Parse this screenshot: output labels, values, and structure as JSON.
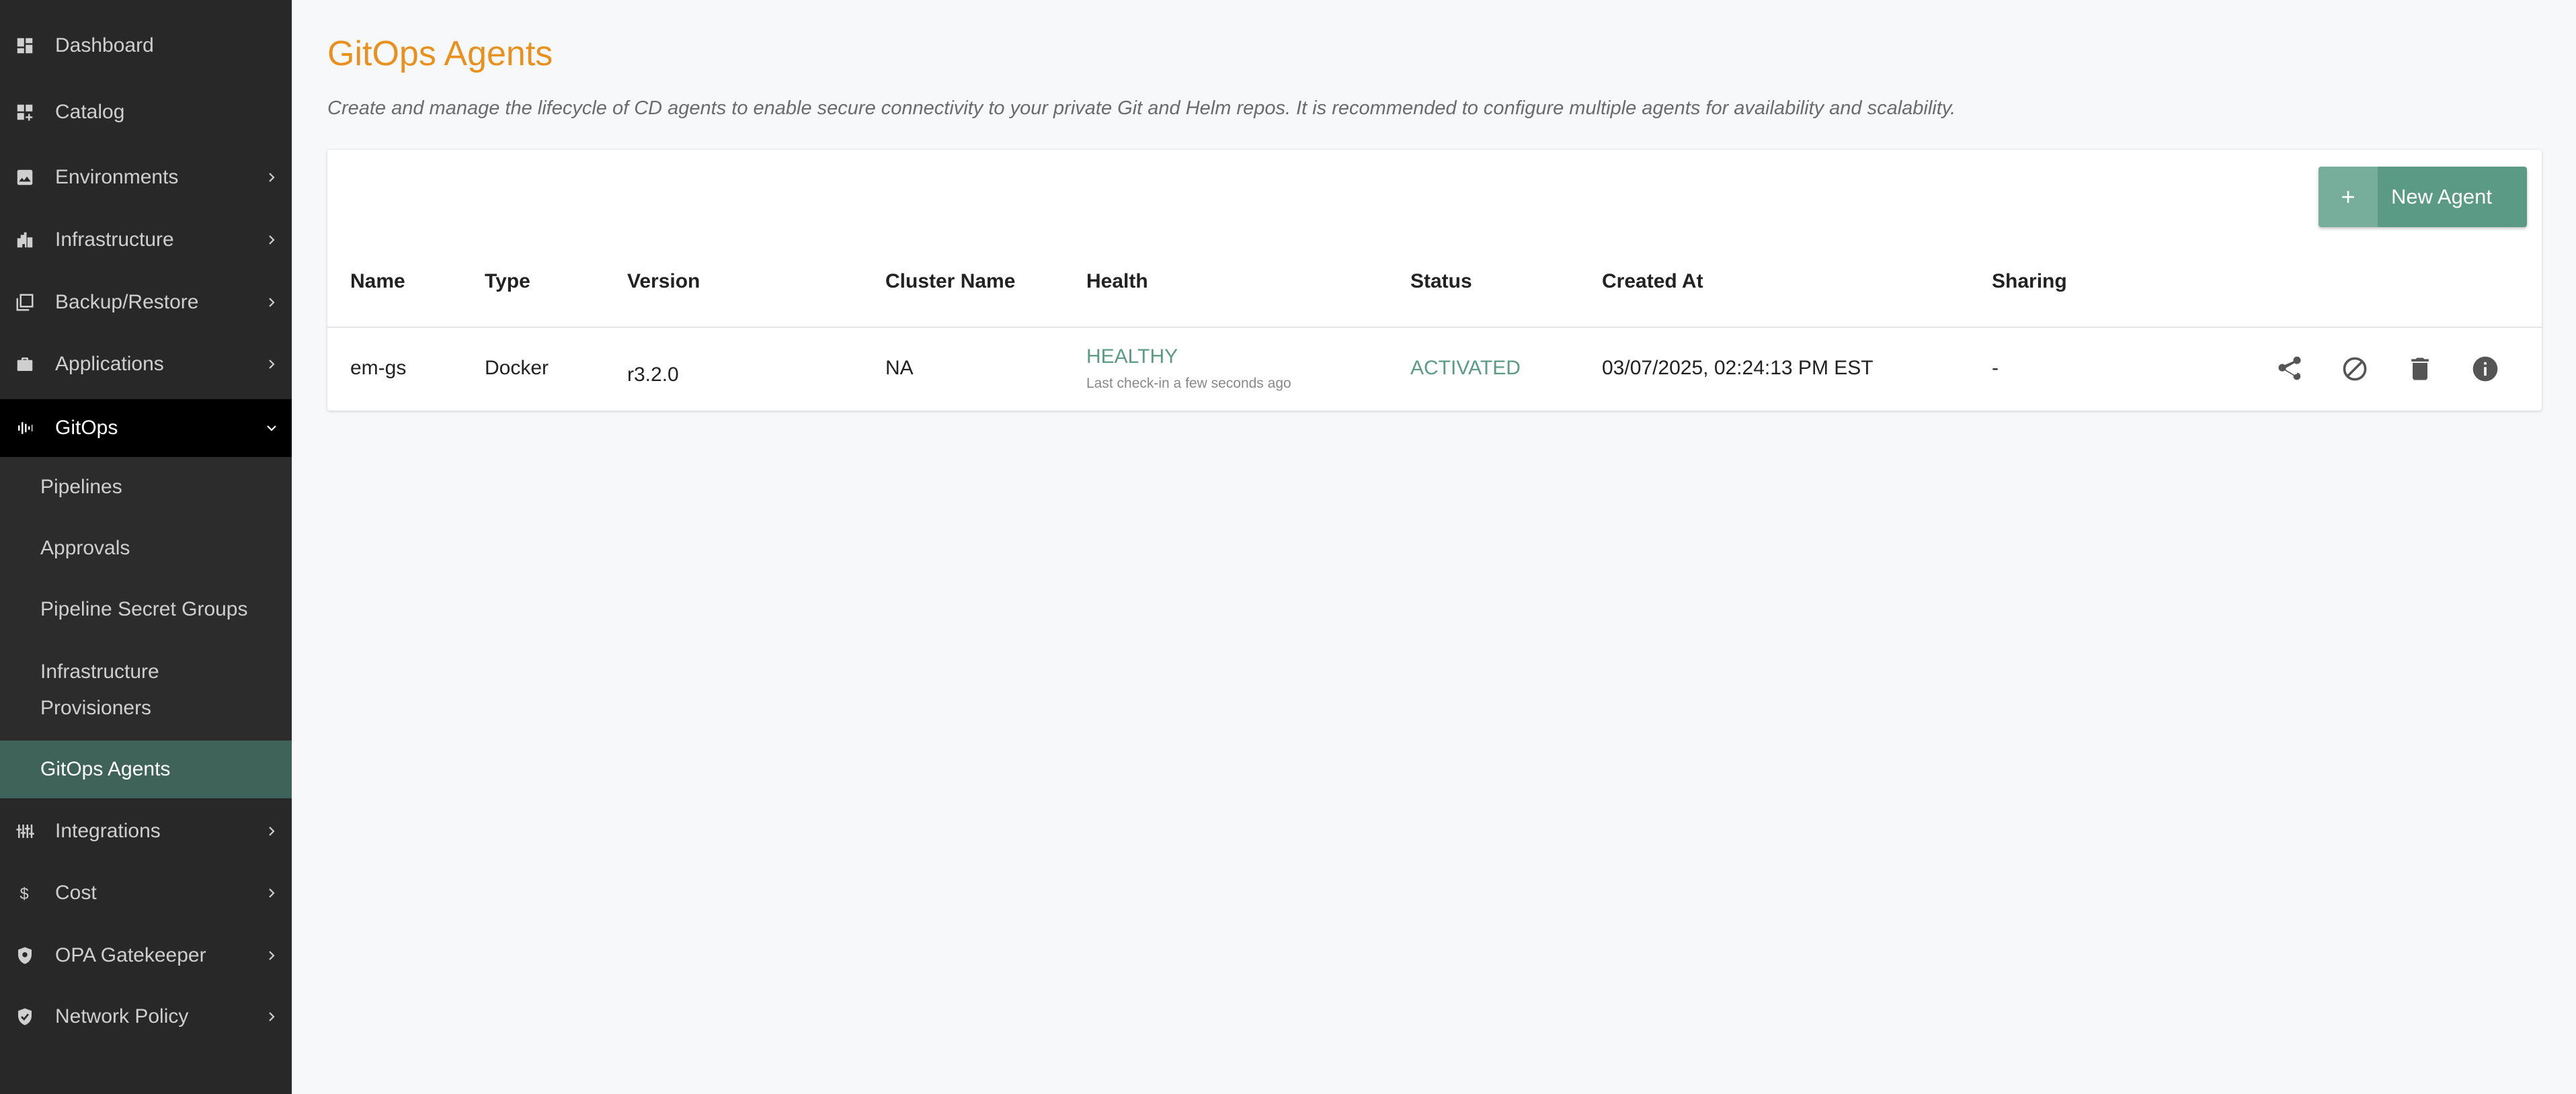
{
  "sidebar": {
    "items": [
      {
        "label": "Dashboard",
        "icon": "dashboard-icon"
      },
      {
        "label": "Catalog",
        "icon": "catalog-icon"
      },
      {
        "label": "Environments",
        "icon": "environments-icon"
      },
      {
        "label": "Infrastructure",
        "icon": "infrastructure-icon"
      },
      {
        "label": "Backup/Restore",
        "icon": "backup-icon"
      },
      {
        "label": "Applications",
        "icon": "applications-icon"
      },
      {
        "label": "GitOps",
        "icon": "gitops-icon"
      },
      {
        "label": "Integrations",
        "icon": "integrations-icon"
      },
      {
        "label": "Cost",
        "icon": "dollar-icon"
      },
      {
        "label": "OPA Gatekeeper",
        "icon": "shield-icon"
      },
      {
        "label": "Network Policy",
        "icon": "shield-check-icon"
      }
    ],
    "gitops_sub": [
      {
        "label": "Pipelines"
      },
      {
        "label": "Approvals"
      },
      {
        "label": "Pipeline Secret Groups"
      },
      {
        "label": "Infrastructure Provisioners"
      },
      {
        "label": "GitOps Agents"
      }
    ]
  },
  "page": {
    "title": "GitOps Agents",
    "description": "Create and manage the lifecycle of CD agents to enable secure connectivity to your private Git and Helm repos. It is recommended to configure multiple agents for availability and scalability."
  },
  "toolbar": {
    "plus_label": "+",
    "new_agent_label": "New Agent"
  },
  "table": {
    "columns": [
      "Name",
      "Type",
      "Version",
      "Cluster Name",
      "Health",
      "Status",
      "Created At",
      "Sharing"
    ],
    "rows": [
      {
        "name": "em-gs",
        "type": "Docker",
        "version": "r3.2.0",
        "cluster_name": "NA",
        "health": "HEALTHY",
        "health_sub": "Last check-in  a few seconds ago",
        "status": "ACTIVATED",
        "created_at": "03/07/2025, 02:24:13 PM EST",
        "sharing": "-"
      }
    ]
  },
  "colors": {
    "accent": "#e8911e",
    "healthy": "#5b9a85",
    "sidebar_bg": "#282828",
    "sidebar_selected": "#3f6358"
  }
}
